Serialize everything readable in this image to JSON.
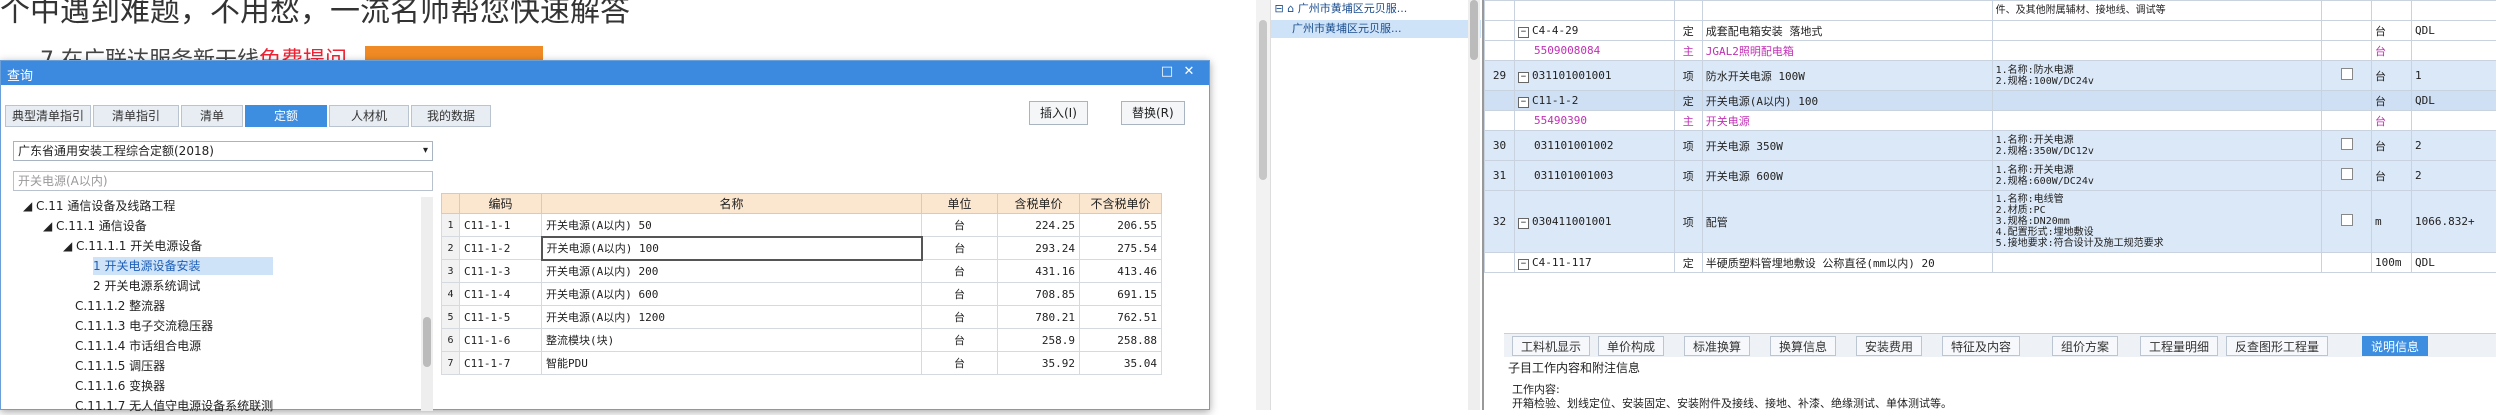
{
  "bg": {
    "line1": "个中遇到难题，不用愁，一流名师帮您快速解答",
    "line2_prefix": "7 在广联达服务新干线",
    "line2_red": "免费提问"
  },
  "midtree": {
    "row1": "广州市黄埔区元贝服...",
    "row2": "广州市黄埔区元贝服..."
  },
  "grid": {
    "rows": [
      {
        "no": "",
        "code": "",
        "type": "",
        "name": "",
        "desc": "件、及其他附属辅材、接地线、调试等",
        "unit": "",
        "qty": "",
        "style": ""
      },
      {
        "no": "",
        "code": "C4-4-29",
        "type": "定",
        "name": "成套配电箱安装 落地式",
        "desc": "",
        "unit": "台",
        "qty": "QDL",
        "style": "",
        "exp": "−"
      },
      {
        "no": "",
        "code": "5509008084",
        "type": "主",
        "name": "JGAL2照明配电箱",
        "desc": "",
        "unit": "台",
        "qty": "",
        "style": "magenta"
      },
      {
        "no": "29",
        "code": "031101001001",
        "type": "项",
        "name": "防水开关电源 100W",
        "desc": "1.名称:防水电源\n2.规格:100W/DC24v",
        "unit": "台",
        "qty": "1",
        "style": "blue",
        "exp": "−",
        "chk": true
      },
      {
        "no": "",
        "code": "C11-1-2",
        "type": "定",
        "name": "开关电源(A以内) 100",
        "desc": "",
        "unit": "台",
        "qty": "QDL",
        "style": "sel",
        "exp": "−"
      },
      {
        "no": "",
        "code": "55490390",
        "type": "主",
        "name": "开关电源",
        "desc": "",
        "unit": "台",
        "qty": "",
        "style": "magenta"
      },
      {
        "no": "30",
        "code": "031101001002",
        "type": "项",
        "name": "开关电源 350W",
        "desc": "1.名称:开关电源\n2.规格:350W/DC12v",
        "unit": "台",
        "qty": "2",
        "style": "blue",
        "chk": true
      },
      {
        "no": "31",
        "code": "031101001003",
        "type": "项",
        "name": "开关电源 600W",
        "desc": "1.名称:开关电源\n2.规格:600W/DC24v",
        "unit": "台",
        "qty": "2",
        "style": "blue",
        "chk": true
      },
      {
        "no": "32",
        "code": "030411001001",
        "type": "项",
        "name": "配管",
        "desc": "1.名称:电线管\n2.材质:PC\n3.规格:DN20mm\n4.配置形式:埋地敷设\n5.接地要求:符合设计及施工规范要求",
        "unit": "m",
        "qty": "1066.832+",
        "style": "blue",
        "exp": "−",
        "chk": true
      },
      {
        "no": "",
        "code": "C4-11-117",
        "type": "定",
        "name": "半硬质塑料管埋地敷设 公称直径(mm以内) 20",
        "desc": "",
        "unit": "100m",
        "qty": "QDL",
        "style": "",
        "exp": "−"
      }
    ]
  },
  "righttabs": [
    "工料机显示",
    "单价构成",
    "标准换算",
    "换算信息",
    "安装费用",
    "特征及内容",
    "组价方案",
    "工程量明细",
    "反查图形工程量",
    "说明信息"
  ],
  "rightinfo": {
    "title": "子目工作内容和附注信息",
    "l1": "工作内容:",
    "l2": "开箱检验、划线定位、安装固定、安装附件及接线、接地、补漆、绝缘测试、单体测试等。"
  },
  "dialog": {
    "title": "查询",
    "tabs": [
      "典型清单指引",
      "清单指引",
      "清单",
      "定额",
      "人材机",
      "我的数据"
    ],
    "insert_btn": "插入(I)",
    "replace_btn": "替换(R)",
    "library": "广东省通用安装工程综合定额(2018)",
    "search_placeholder": "开关电源(A以内)",
    "tree": [
      "C.11 通信设备及线路工程",
      "C.11.1 通信设备",
      "C.11.1.1 开关电源设备",
      "1 开关电源设备安装",
      "2 开关电源系统调试",
      "C.11.1.2 整流器",
      "C.11.1.3 电子交流稳压器",
      "C.11.1.4 市话组合电源",
      "C.11.1.5 调压器",
      "C.11.1.6 变换器",
      "C.11.1.7 无人值守电源设备系统联测"
    ],
    "table": {
      "headers": [
        "编码",
        "名称",
        "单位",
        "含税单价",
        "不含税单价"
      ],
      "rows": [
        {
          "i": "1",
          "code": "C11-1-1",
          "name": "开关电源(A以内) 50",
          "unit": "台",
          "p1": "224.25",
          "p2": "206.55"
        },
        {
          "i": "2",
          "code": "C11-1-2",
          "name": "开关电源(A以内) 100",
          "unit": "台",
          "p1": "293.24",
          "p2": "275.54"
        },
        {
          "i": "3",
          "code": "C11-1-3",
          "name": "开关电源(A以内) 200",
          "unit": "台",
          "p1": "431.16",
          "p2": "413.46"
        },
        {
          "i": "4",
          "code": "C11-1-4",
          "name": "开关电源(A以内) 600",
          "unit": "台",
          "p1": "708.85",
          "p2": "691.15"
        },
        {
          "i": "5",
          "code": "C11-1-5",
          "name": "开关电源(A以内) 1200",
          "unit": "台",
          "p1": "780.21",
          "p2": "762.51"
        },
        {
          "i": "6",
          "code": "C11-1-6",
          "name": "整流模块(块)",
          "unit": "台",
          "p1": "258.9",
          "p2": "258.88"
        },
        {
          "i": "7",
          "code": "C11-1-7",
          "name": "智能PDU",
          "unit": "台",
          "p1": "35.92",
          "p2": "35.04"
        }
      ]
    }
  }
}
